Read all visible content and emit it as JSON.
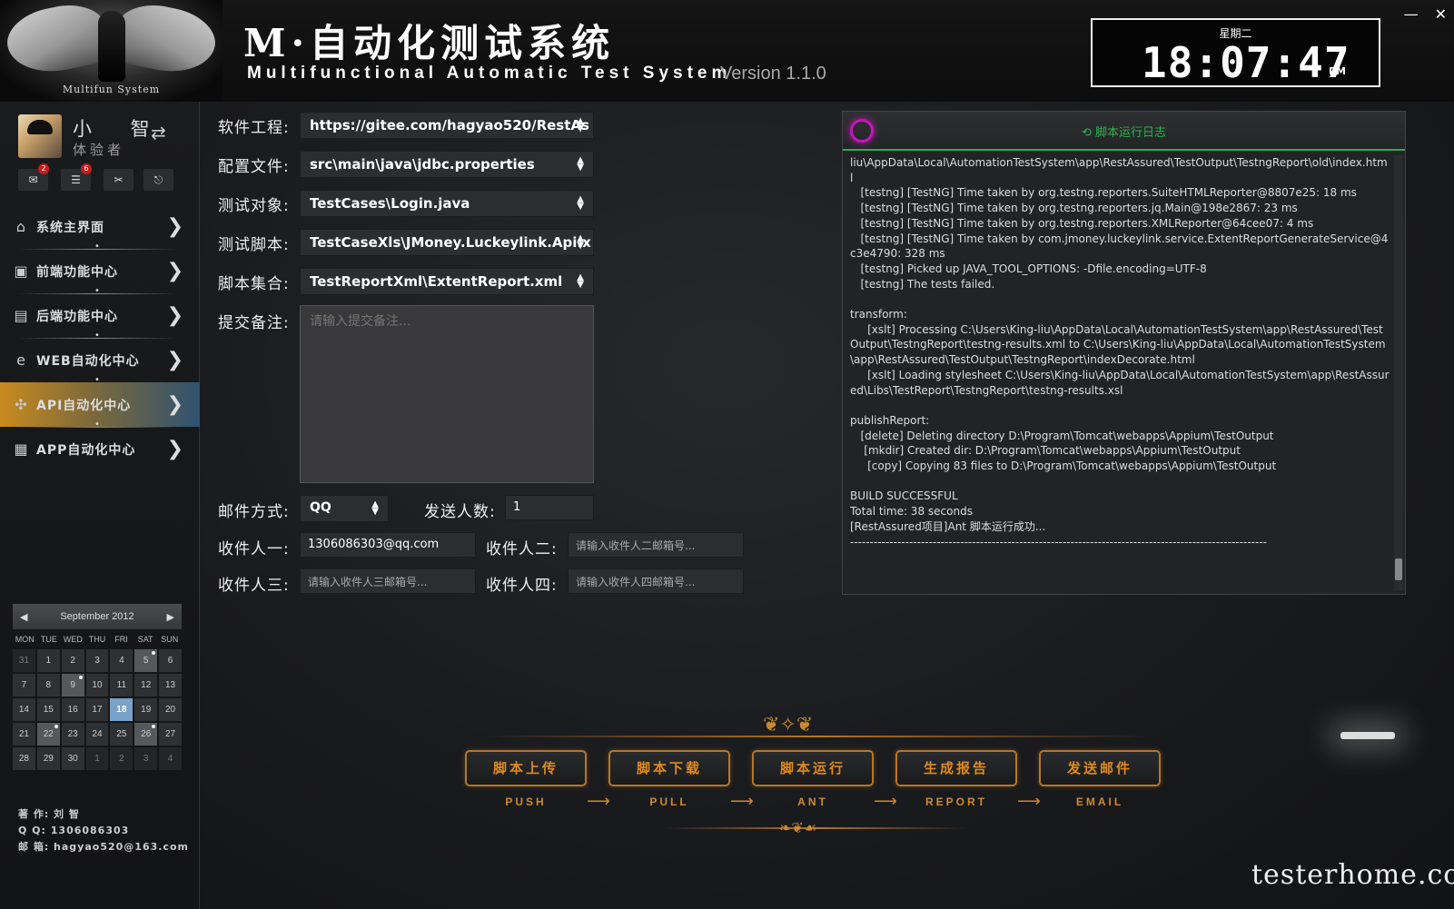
{
  "header": {
    "logo_caption": "Multifun System",
    "title_cn": "M·自动化测试系统",
    "title_en": "Multifunctional Automatic Test System",
    "version": "Version 1.1.0",
    "clock": {
      "weekday": "星期二",
      "time": "18:07:47",
      "ampm": "PM"
    }
  },
  "user": {
    "name": "小 智",
    "role": "体验者"
  },
  "quick_icons": [
    {
      "name": "inbox-icon",
      "glyph": "✉",
      "badge": "2"
    },
    {
      "name": "list-icon",
      "glyph": "☰",
      "badge": "6"
    },
    {
      "name": "tools-icon",
      "glyph": "✂",
      "badge": ""
    },
    {
      "name": "exit-icon",
      "glyph": "⎋",
      "badge": ""
    }
  ],
  "nav": [
    {
      "label": "系统主界面",
      "icon": "⌂",
      "active": false
    },
    {
      "label": "前端功能中心",
      "icon": "▣",
      "active": false
    },
    {
      "label": "后端功能中心",
      "icon": "▤",
      "active": false
    },
    {
      "label": "WEB自动化中心",
      "icon": "e",
      "active": false
    },
    {
      "label": "API自动化中心",
      "icon": "✣",
      "active": true
    },
    {
      "label": "APP自动化中心",
      "icon": "▦",
      "active": false
    }
  ],
  "calendar": {
    "month_label": "September 2012",
    "weekdays": [
      "MON",
      "TUE",
      "WED",
      "THU",
      "FRI",
      "SAT",
      "SUN"
    ],
    "days": [
      {
        "d": "31",
        "out": true
      },
      {
        "d": "1"
      },
      {
        "d": "2"
      },
      {
        "d": "3"
      },
      {
        "d": "4"
      },
      {
        "d": "5",
        "mark": true
      },
      {
        "d": "6"
      },
      {
        "d": "7"
      },
      {
        "d": "8"
      },
      {
        "d": "9",
        "mark": true
      },
      {
        "d": "10"
      },
      {
        "d": "11"
      },
      {
        "d": "12"
      },
      {
        "d": "13"
      },
      {
        "d": "14"
      },
      {
        "d": "15"
      },
      {
        "d": "16"
      },
      {
        "d": "17"
      },
      {
        "d": "18",
        "today": true
      },
      {
        "d": "19"
      },
      {
        "d": "20"
      },
      {
        "d": "21"
      },
      {
        "d": "22",
        "mark": true
      },
      {
        "d": "23"
      },
      {
        "d": "24"
      },
      {
        "d": "25"
      },
      {
        "d": "26",
        "mark": true
      },
      {
        "d": "27"
      },
      {
        "d": "28"
      },
      {
        "d": "29"
      },
      {
        "d": "30"
      },
      {
        "d": "1",
        "out": true
      },
      {
        "d": "2",
        "out": true
      },
      {
        "d": "3",
        "out": true
      },
      {
        "d": "4",
        "out": true
      }
    ]
  },
  "author": {
    "author_line": "著 作: 刘 智",
    "qq_line": "Q Q: 1306086303",
    "email_line": "邮 箱: hagyao520@163.com"
  },
  "form": {
    "project_label": "软件工程:",
    "project_value": "https://gitee.com/hagyao520/RestAs",
    "config_label": "配置文件:",
    "config_value": "src\\main\\java\\jdbc.properties",
    "target_label": "测试对象:",
    "target_value": "TestCases\\Login.java",
    "script_label": "测试脚本:",
    "script_value": "TestCaseXls\\JMoney.Luckeylink.Api.x",
    "suite_label": "脚本集合:",
    "suite_value": "TestReportXml\\ExtentReport.xml",
    "remark_label": "提交备注:",
    "remark_placeholder": "请输入提交备注...",
    "mail_label": "邮件方式:",
    "mail_value": "QQ",
    "sender_count_label": "发送人数:",
    "sender_count_value": "1",
    "r1_label": "收件人一:",
    "r1_value": "1306086303@qq.com",
    "r2_label": "收件人二:",
    "r2_placeholder": "请输入收件人二邮箱号...",
    "r3_label": "收件人三:",
    "r3_placeholder": "请输入收件人三邮箱号...",
    "r4_label": "收件人四:",
    "r4_placeholder": "请输入收件人四邮箱号..."
  },
  "log": {
    "title": "⟲ 脚本运行日志",
    "text": "liu\\AppData\\Local\\AutomationTestSystem\\app\\RestAssured\\TestOutput\\TestngReport\\old\\index.html\n   [testng] [TestNG] Time taken by org.testng.reporters.SuiteHTMLReporter@8807e25: 18 ms\n   [testng] [TestNG] Time taken by org.testng.reporters.jq.Main@198e2867: 23 ms\n   [testng] [TestNG] Time taken by org.testng.reporters.XMLReporter@64cee07: 4 ms\n   [testng] [TestNG] Time taken by com.jmoney.luckeylink.service.ExtentReportGenerateService@4c3e4790: 328 ms\n   [testng] Picked up JAVA_TOOL_OPTIONS: -Dfile.encoding=UTF-8\n   [testng] The tests failed.\n\ntransform:\n     [xslt] Processing C:\\Users\\King-liu\\AppData\\Local\\AutomationTestSystem\\app\\RestAssured\\TestOutput\\TestngReport\\testng-results.xml to C:\\Users\\King-liu\\AppData\\Local\\AutomationTestSystem\\app\\RestAssured\\TestOutput\\TestngReport\\indexDecorate.html\n     [xslt] Loading stylesheet C:\\Users\\King-liu\\AppData\\Local\\AutomationTestSystem\\app\\RestAssured\\Libs\\TestReport\\TestngReport\\testng-results.xsl\n\npublishReport:\n   [delete] Deleting directory D:\\Program\\Tomcat\\webapps\\Appium\\TestOutput\n    [mkdir] Created dir: D:\\Program\\Tomcat\\webapps\\Appium\\TestOutput\n     [copy] Copying 83 files to D:\\Program\\Tomcat\\webapps\\Appium\\TestOutput\n\nBUILD SUCCESSFUL\nTotal time: 38 seconds\n[RestAssured项目]Ant 脚本运行成功...\n----------------------------------------------------------------------------------------------------------"
  },
  "workflow": [
    {
      "label": "脚本上传",
      "sub": "PUSH"
    },
    {
      "label": "脚本下载",
      "sub": "PULL"
    },
    {
      "label": "脚本运行",
      "sub": "ANT"
    },
    {
      "label": "生成报告",
      "sub": "REPORT"
    },
    {
      "label": "发送邮件",
      "sub": "EMAIL"
    }
  ],
  "watermark": "testerhome.com",
  "colors": {
    "accent_orange": "#e08a1e",
    "log_green": "#2db34d",
    "active_nav": "#c98a20"
  }
}
